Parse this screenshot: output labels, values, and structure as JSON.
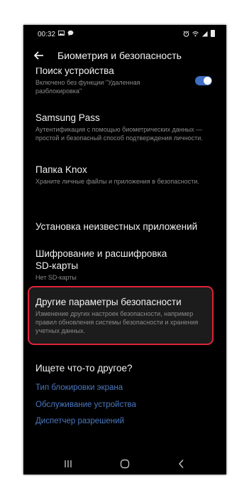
{
  "status_bar": {
    "time": "00:32",
    "left_icons": [
      "image-icon",
      "chat-bubble-icon"
    ],
    "right_icons": [
      "alarm-icon",
      "wifi-icon",
      "signal-icon",
      "battery-icon"
    ]
  },
  "header": {
    "title": "Биометрия и безопасность"
  },
  "settings": {
    "find_device": {
      "title": "Поиск устройства",
      "description": "Включено без функции \"Удаленная разблокировка\"",
      "toggle_on": true
    },
    "samsung_pass": {
      "title": "Samsung Pass",
      "description": "Аутентификация с помощью биометрических данных — простой и безопасный способ подтверждения личности."
    },
    "knox_folder": {
      "title": "Папка Knox",
      "description": "Храните личные файлы и приложения в безопасности."
    },
    "unknown_apps": {
      "title": "Установка неизвестных приложений"
    },
    "sd_encryption": {
      "title": "Шифрование и расшифровка SD-карты",
      "description": "Нет SD-карты"
    },
    "other_security": {
      "title": "Другие параметры безопасности",
      "description": "Изменение других настроек безопасности, например правил обновления системы безопасности и хранения учетных данных."
    }
  },
  "looking_for_else": {
    "title": "Ищете что-то другое?",
    "links": [
      "Тип блокировки экрана",
      "Обслуживание устройства",
      "Диспетчер разрешений"
    ]
  },
  "nav_bar": {
    "buttons": [
      "recents-icon",
      "home-icon",
      "back-icon"
    ]
  },
  "colors": {
    "background": "#000000",
    "accent": "#4a78bf",
    "toggle": "#3e6fc4",
    "highlight": "#e0233b"
  }
}
